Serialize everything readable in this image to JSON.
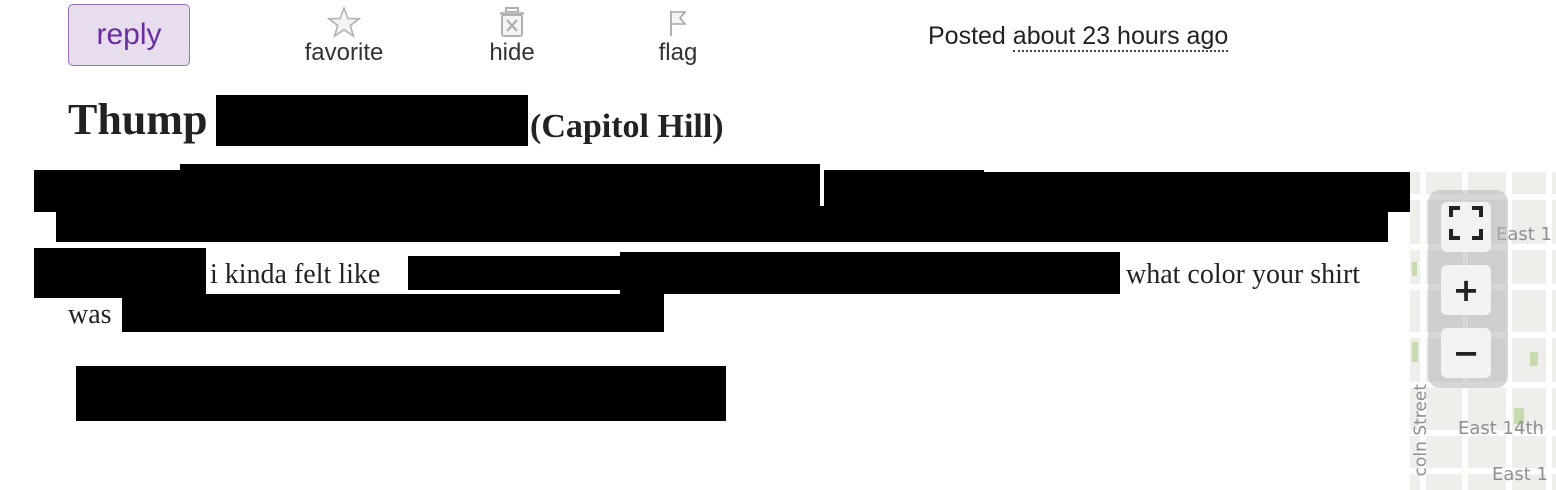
{
  "actions": {
    "reply_label": "reply",
    "favorite_label": "favorite",
    "hide_label": "hide",
    "flag_label": "flag"
  },
  "posted": {
    "prefix": "Posted",
    "ago": "about 23 hours ago"
  },
  "title": {
    "name": "Thump",
    "area": "(Capitol Hill)"
  },
  "body": {
    "fragment_1": "i kinda felt like",
    "fragment_2": "what color your shirt",
    "fragment_3": "was"
  },
  "map": {
    "label_east_top": "East 1",
    "label_east_14th": "East 14th",
    "label_east_bottom": "East 1",
    "label_vertical_street": "coln Street",
    "zoom_in": "+",
    "zoom_out": "−"
  },
  "colors": {
    "reply_bg": "#e8dcef",
    "reply_border": "#9b6fc1",
    "reply_text": "#6a2ea0",
    "redaction": "#000000"
  },
  "icons": [
    "star-icon",
    "trash-hide-icon",
    "flag-icon",
    "fullscreen-icon"
  ]
}
